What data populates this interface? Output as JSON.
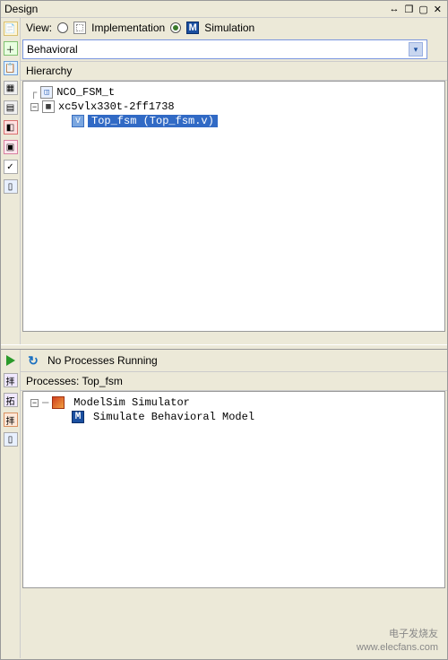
{
  "panel": {
    "title": "Design",
    "ctrl_move": "↔",
    "ctrl_restore": "❐",
    "ctrl_maximize": "▢",
    "ctrl_close": "✕"
  },
  "view": {
    "label": "View:",
    "implementation": "Implementation",
    "simulation": "Simulation",
    "selected": "simulation"
  },
  "dropdown": {
    "value": "Behavioral"
  },
  "hierarchy": {
    "header": "Hierarchy",
    "project": "NCO_FSM_t",
    "device": "xc5vlx330t-2ff1738",
    "module": "Top_fsm (Top_fsm.v)",
    "device_handle": "−"
  },
  "status": {
    "text": "No Processes Running"
  },
  "processes": {
    "header_prefix": "Processes: ",
    "target": "Top_fsm",
    "group": "ModelSim Simulator",
    "item": "Simulate Behavioral Model",
    "group_handle": "−"
  },
  "watermark": {
    "line1": "电子发烧友",
    "line2": "www.elecfans.com"
  }
}
